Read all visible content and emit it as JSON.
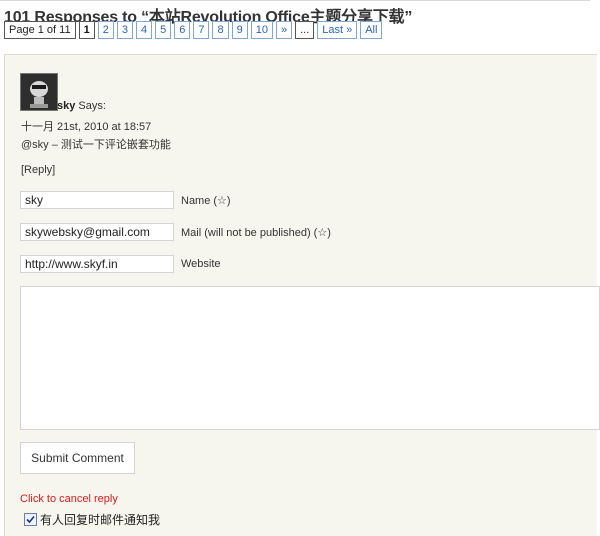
{
  "heading": "101 Responses to “本站Revolution Office主题分享下载”",
  "pager": {
    "info": "Page 1 of 11",
    "current": "1",
    "pages": [
      "2",
      "3",
      "4",
      "5",
      "6",
      "7",
      "8",
      "9",
      "10"
    ],
    "next": "»",
    "dots": "...",
    "last": "Last »",
    "all": "All"
  },
  "comment": {
    "avatar_icon": "user-avatar-icon",
    "author": "sky",
    "says": " Says:",
    "date": "十一月 21st, 2010 at 18:57",
    "text": "@sky – 测试一下评论嵌套功能",
    "reply": "[Reply]"
  },
  "form": {
    "name_value": "sky",
    "name_label": "Name (☆)",
    "mail_value": "skywebsky@gmail.com",
    "mail_label": "Mail (will not be published) (☆)",
    "website_value": "http://www.skyf.in",
    "website_label": "Website",
    "submit_label": "Submit Comment",
    "cancel_label": "Click to cancel reply",
    "notify_label": "有人回复时邮件通知我",
    "notify_checked": true
  },
  "colors": {
    "link": "#2a64b5",
    "cancel": "#d7191c",
    "panel": "#f6f6ef"
  }
}
